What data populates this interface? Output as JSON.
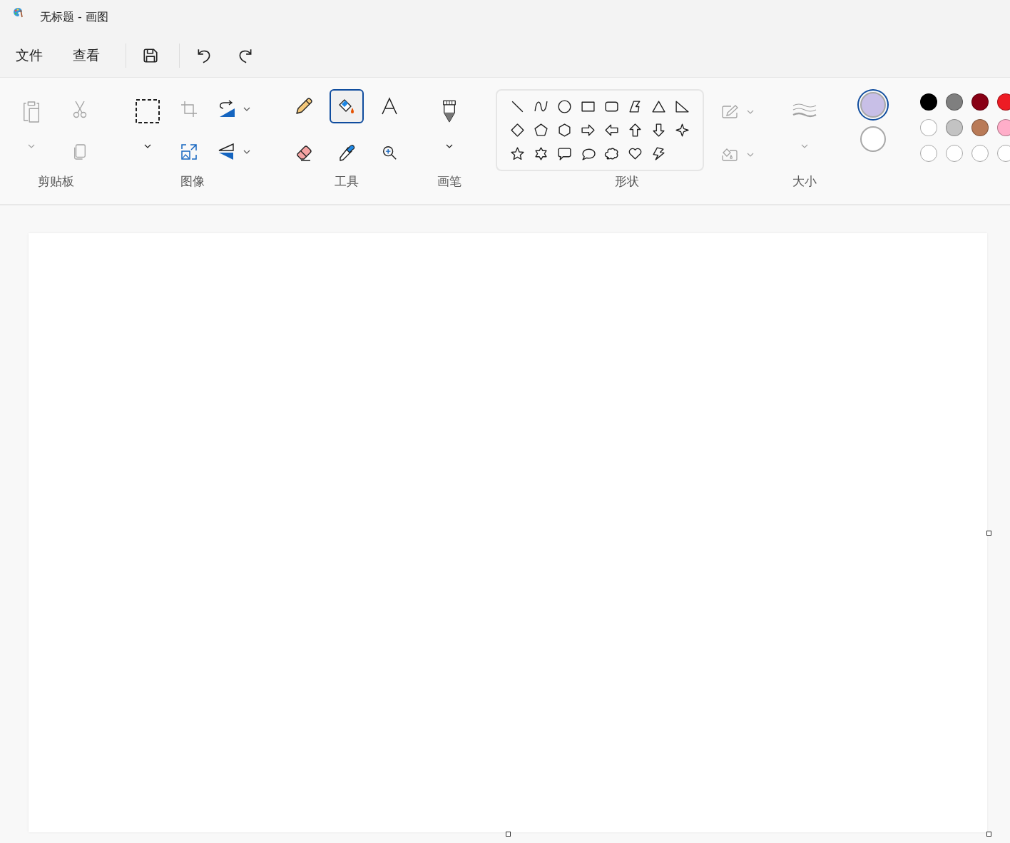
{
  "window": {
    "title": "无标题 - 画图"
  },
  "menu": [
    {
      "label": "文件"
    },
    {
      "label": "查看"
    }
  ],
  "quick_access": [
    {
      "kind": "save"
    },
    {
      "kind": "undo"
    },
    {
      "kind": "redo"
    }
  ],
  "clipboard": {
    "label": "剪贴板",
    "paste_disabled": true,
    "cut_disabled": true,
    "copy_disabled": true
  },
  "image": {
    "label": "图像",
    "crop_disabled": true
  },
  "tools": {
    "label": "工具",
    "items": [
      {
        "kind": "pencil",
        "selected": false
      },
      {
        "kind": "fill",
        "selected": true
      },
      {
        "kind": "text",
        "selected": false
      },
      {
        "kind": "eraser",
        "selected": false
      },
      {
        "kind": "picker",
        "selected": false
      },
      {
        "kind": "magnifier",
        "selected": false
      }
    ]
  },
  "brushes": {
    "label": "画笔"
  },
  "shapes": {
    "label": "形状",
    "outline_disabled": true,
    "fill_disabled": true
  },
  "size": {
    "label": "大小",
    "disabled": true
  },
  "colors": {
    "current": [
      {
        "color": "#c8bfe7",
        "selected": true
      },
      {
        "color": "#ffffff",
        "selected": false
      }
    ],
    "palette": [
      {
        "kind": "color",
        "color": "#000000"
      },
      {
        "kind": "color",
        "color": "#7f7f7f"
      },
      {
        "kind": "color",
        "color": "#880015"
      },
      {
        "kind": "color",
        "color": "#ed1c24"
      },
      {
        "kind": "color",
        "color": "#ffffff"
      },
      {
        "kind": "color",
        "color": "#c3c3c3"
      },
      {
        "kind": "color",
        "color": "#b97a57"
      },
      {
        "kind": "color",
        "color": "#ffaec9"
      },
      {
        "kind": "empty"
      },
      {
        "kind": "empty"
      },
      {
        "kind": "empty"
      },
      {
        "kind": "empty"
      }
    ]
  }
}
